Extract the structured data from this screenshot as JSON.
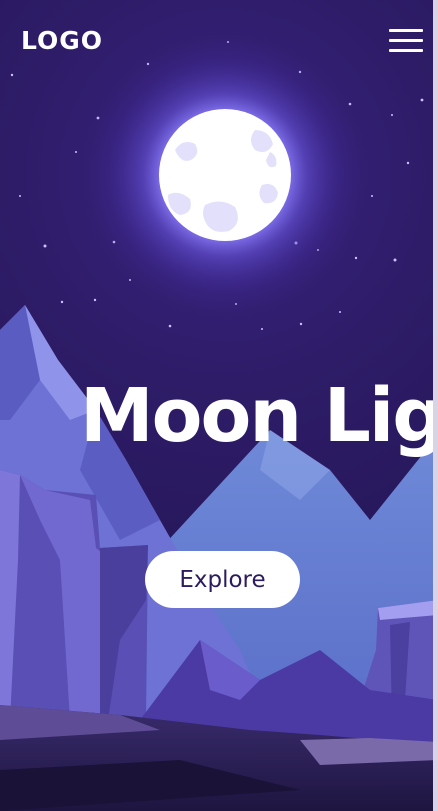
{
  "header": {
    "logo_text": "LOGO",
    "menu_icon": "hamburger-menu-icon"
  },
  "hero": {
    "title": "Moon Light",
    "cta_label": "Explore"
  },
  "colors": {
    "sky": "#2b1a5c",
    "moon": "#ffffff",
    "moon_glow": "#7b6cf0",
    "mountain_light": "#7a83d8",
    "mountain_dark": "#4a3fa6",
    "rock": "#6a5ec4",
    "ground": "#2a1f4e",
    "button_text": "#2c1b5e"
  }
}
